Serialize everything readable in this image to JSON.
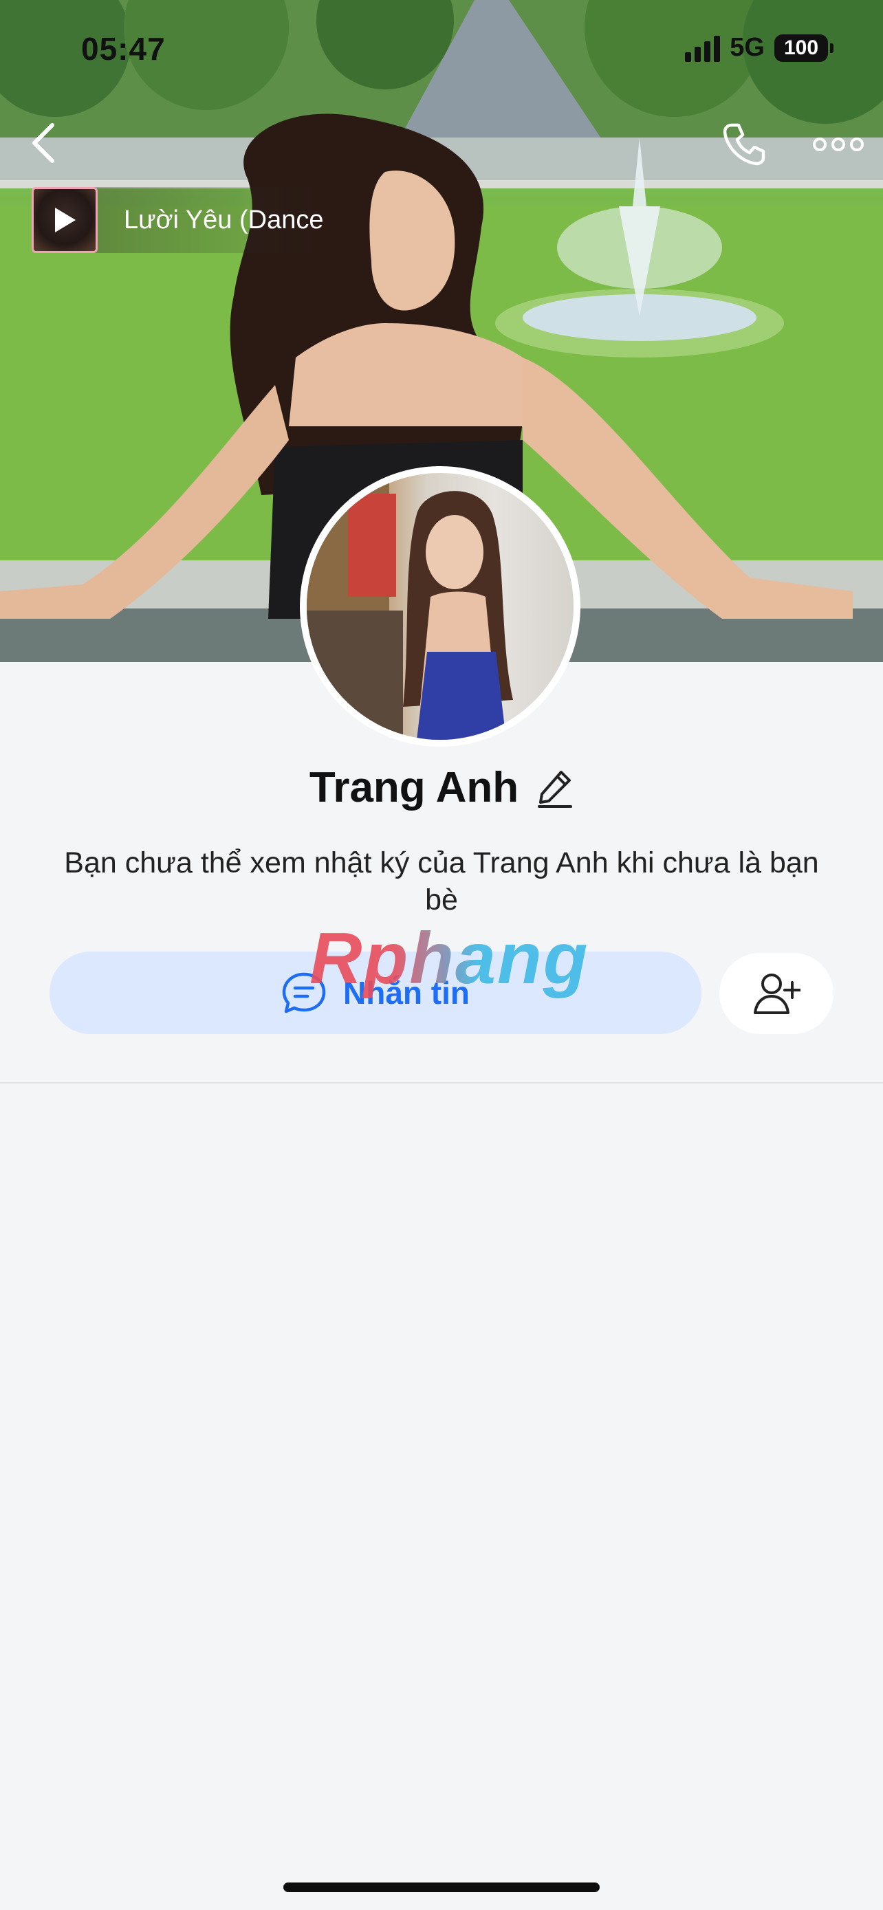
{
  "status_bar": {
    "time": "05:47",
    "network": "5G",
    "battery": "100"
  },
  "nav": {
    "back_icon": "chevron-left-icon",
    "call_icon": "phone-icon",
    "more_icon": "more-dots-icon"
  },
  "music": {
    "title": "Lười Yêu (Dance",
    "play_icon": "play-icon"
  },
  "profile": {
    "name": "Trang Anh",
    "edit_icon": "pencil-icon",
    "notice": "Bạn chưa thể xem nhật ký của Trang Anh khi chưa là bạn bè"
  },
  "actions": {
    "message_label": "Nhắn tin",
    "message_icon": "chat-bubble-icon",
    "add_friend_icon": "add-friend-icon"
  },
  "watermark": "Rphang",
  "colors": {
    "accent": "#1e6ef5",
    "message_button_bg": "#dbe8fd",
    "page_bg": "#f4f5f7"
  }
}
